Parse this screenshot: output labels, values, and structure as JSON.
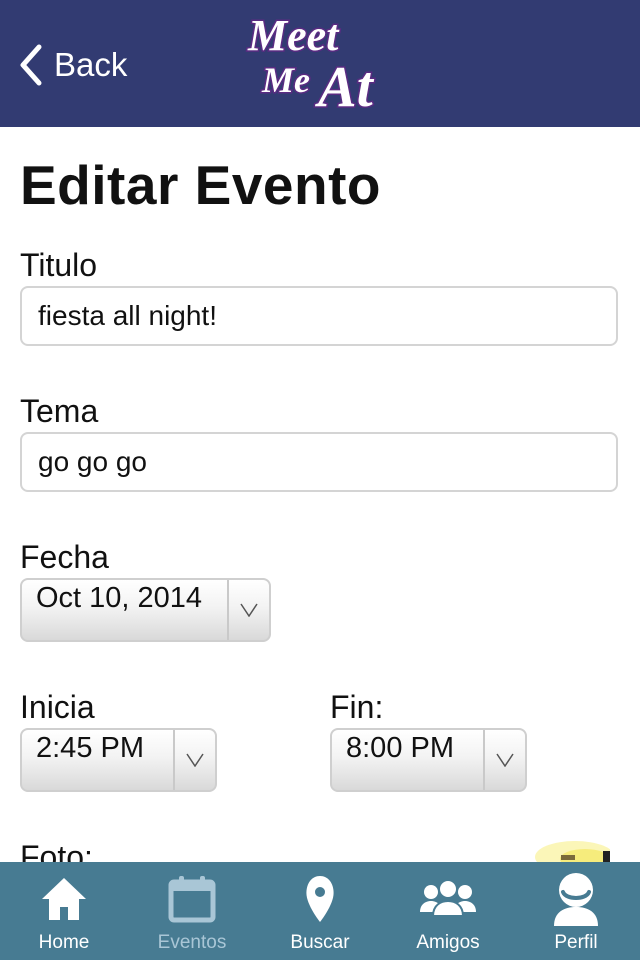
{
  "header": {
    "back_label": "Back",
    "logo_text_line1": "Meet",
    "logo_text_line2": "Me",
    "logo_text_line3": "At"
  },
  "page": {
    "title": "Editar Evento"
  },
  "form": {
    "titulo": {
      "label": "Titulo",
      "value": "fiesta all night!"
    },
    "tema": {
      "label": "Tema",
      "value": "go go go"
    },
    "fecha": {
      "label": "Fecha",
      "value": "Oct 10, 2014"
    },
    "inicia": {
      "label": "Inicia",
      "value": "2:45 PM"
    },
    "fin": {
      "label": "Fin:",
      "value": "8:00 PM"
    },
    "foto": {
      "label": "Foto:"
    }
  },
  "tabbar": {
    "items": [
      {
        "label": "Home",
        "icon": "home-icon",
        "active": false
      },
      {
        "label": "Eventos",
        "icon": "calendar-icon",
        "active": true
      },
      {
        "label": "Buscar",
        "icon": "map-pin-icon",
        "active": false
      },
      {
        "label": "Amigos",
        "icon": "friends-icon",
        "active": false
      },
      {
        "label": "Perfil",
        "icon": "profile-icon",
        "active": false
      }
    ]
  },
  "colors": {
    "header_bg": "#323b72",
    "tabbar_bg": "#477b92",
    "tab_active": "#a9c6d6",
    "logo_fill": "#ffffff",
    "logo_outline": "#5a2b82"
  }
}
